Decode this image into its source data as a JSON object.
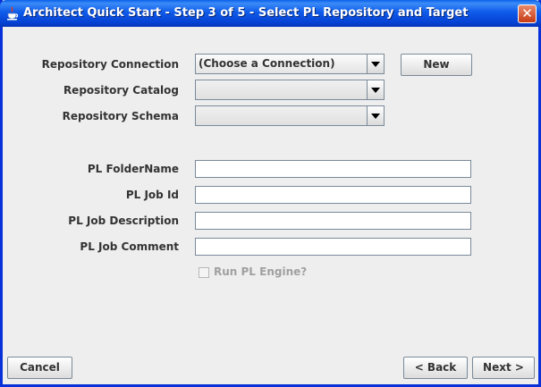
{
  "window": {
    "title": "Architect Quick Start - Step 3 of 5 - Select PL Repository and Target",
    "close_glyph": "✕",
    "icon": "java-cup-icon"
  },
  "repository": {
    "connection_label": "Repository Connection",
    "connection_value": "(Choose a Connection)",
    "catalog_label": "Repository Catalog",
    "catalog_value": "",
    "schema_label": "Repository Schema",
    "schema_value": "",
    "new_button": "New"
  },
  "pl": {
    "folder_label": "PL FolderName",
    "folder_value": "",
    "job_id_label": "PL Job Id",
    "job_id_value": "",
    "job_desc_label": "PL Job Description",
    "job_desc_value": "",
    "job_comment_label": "PL Job Comment",
    "job_comment_value": "",
    "run_engine_label": "Run PL Engine?",
    "run_engine_checked": false
  },
  "footer": {
    "cancel": "Cancel",
    "back": "< Back",
    "next": "Next >"
  },
  "colors": {
    "title_bar": "#0A5FE8",
    "close_button": "#C63B14",
    "content_bg": "#EEEEEE"
  }
}
